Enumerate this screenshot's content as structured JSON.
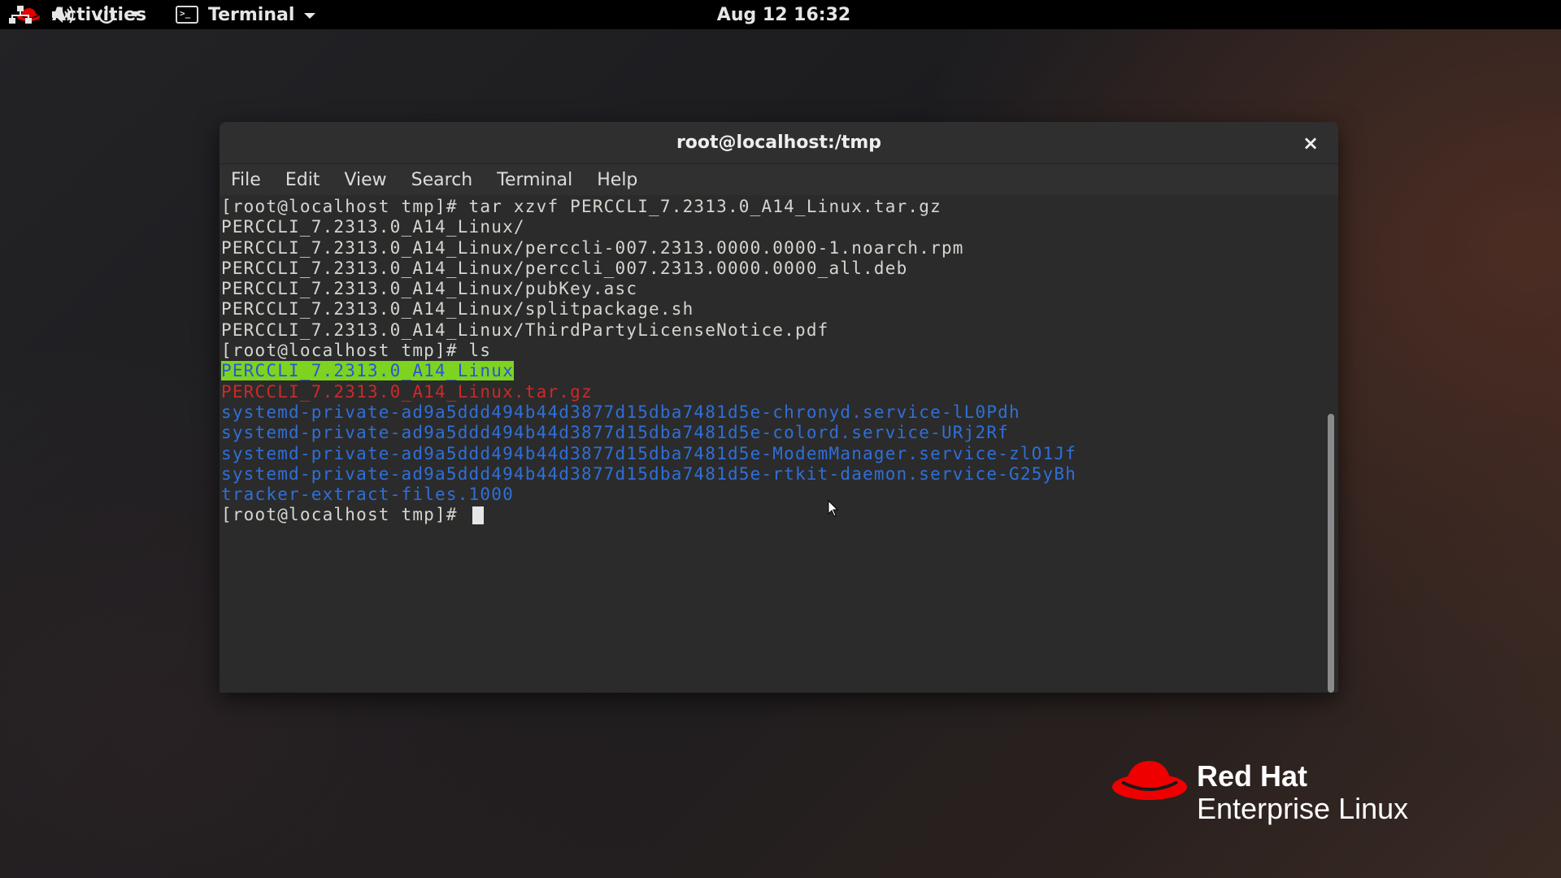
{
  "topbar": {
    "activities_label": "Activities",
    "app_menu_label": "Terminal",
    "clock": "Aug 12 16:32",
    "icons": [
      "network-icon",
      "volume-icon",
      "power-icon",
      "chevron-down-icon"
    ]
  },
  "window": {
    "title": "root@localhost:/tmp",
    "close_glyph": "×",
    "menus": [
      "File",
      "Edit",
      "View",
      "Search",
      "Terminal",
      "Help"
    ],
    "scroll_position": 0.44,
    "scroll_visible_fraction": 0.56
  },
  "terminal": {
    "lines": [
      {
        "text": "[root@localhost tmp]# tar xzvf PERCCLI_7.2313.0_A14_Linux.tar.gz",
        "style": "normal"
      },
      {
        "text": "PERCCLI_7.2313.0_A14_Linux/",
        "style": "normal"
      },
      {
        "text": "PERCCLI_7.2313.0_A14_Linux/perccli-007.2313.0000.0000-1.noarch.rpm",
        "style": "normal"
      },
      {
        "text": "PERCCLI_7.2313.0_A14_Linux/perccli_007.2313.0000.0000_all.deb",
        "style": "normal"
      },
      {
        "text": "PERCCLI_7.2313.0_A14_Linux/pubKey.asc",
        "style": "normal"
      },
      {
        "text": "PERCCLI_7.2313.0_A14_Linux/splitpackage.sh",
        "style": "normal"
      },
      {
        "text": "PERCCLI_7.2313.0_A14_Linux/ThirdPartyLicenseNotice.pdf",
        "style": "normal"
      },
      {
        "text": "[root@localhost tmp]# ls",
        "style": "normal"
      },
      {
        "text": "PERCCLI_7.2313.0_A14_Linux",
        "style": "dir-hl"
      },
      {
        "text": "PERCCLI_7.2313.0_A14_Linux.tar.gz",
        "style": "red"
      },
      {
        "text": "systemd-private-ad9a5ddd494b44d3877d15dba7481d5e-chronyd.service-lL0Pdh",
        "style": "blue"
      },
      {
        "text": "systemd-private-ad9a5ddd494b44d3877d15dba7481d5e-colord.service-URj2Rf",
        "style": "blue"
      },
      {
        "text": "systemd-private-ad9a5ddd494b44d3877d15dba7481d5e-ModemManager.service-zlO1Jf",
        "style": "blue"
      },
      {
        "text": "systemd-private-ad9a5ddd494b44d3877d15dba7481d5e-rtkit-daemon.service-G25yBh",
        "style": "blue"
      },
      {
        "text": "tracker-extract-files.1000",
        "style": "blue"
      }
    ],
    "prompt": "[root@localhost tmp]# "
  },
  "branding": {
    "brand": "Red Hat",
    "product": "Enterprise Linux",
    "hat_color": "#ee0000"
  },
  "colors": {
    "dir_highlight_bg": "#7ed321",
    "dir_highlight_fg": "#2a55d6",
    "archive": "#cc2929",
    "directory": "#2f6fd8"
  }
}
